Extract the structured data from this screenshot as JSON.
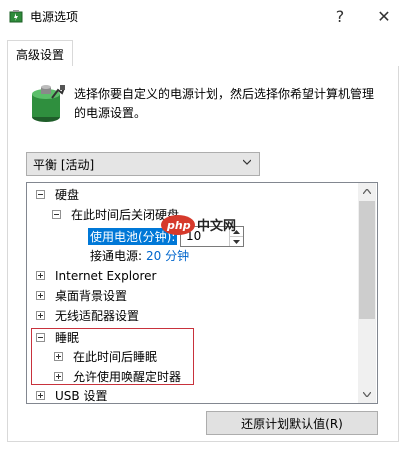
{
  "window": {
    "title": "电源选项",
    "help_glyph": "?",
    "close_glyph": "✕"
  },
  "tabs": [
    {
      "label": "高级设置"
    }
  ],
  "description": "选择你要自定义的电源计划，然后选择你希望计算机管理的电源设置。",
  "plan_select": {
    "value": "平衡 [活动]"
  },
  "tree": {
    "disk": {
      "label": "硬盘",
      "child": "在此时间后关闭硬盘",
      "battery_label": "使用电池(分钟):",
      "battery_value": "10",
      "plugged_label": "接通电源:",
      "plugged_value": "20 分钟"
    },
    "items": [
      {
        "label": "Internet Explorer"
      },
      {
        "label": "桌面背景设置"
      },
      {
        "label": "无线适配器设置"
      }
    ],
    "sleep": {
      "label": "睡眠",
      "children": [
        "在此时间后睡眠",
        "允许使用唤醒定时器"
      ]
    },
    "usb": {
      "label": "USB 设置"
    }
  },
  "restore_button": "还原计划默认值(R)",
  "watermark": {
    "left": "php",
    "right": "中文网"
  },
  "colors": {
    "selection": "#0078d7",
    "highlight_box": "#c8323c",
    "link_blue": "#0066cc"
  }
}
